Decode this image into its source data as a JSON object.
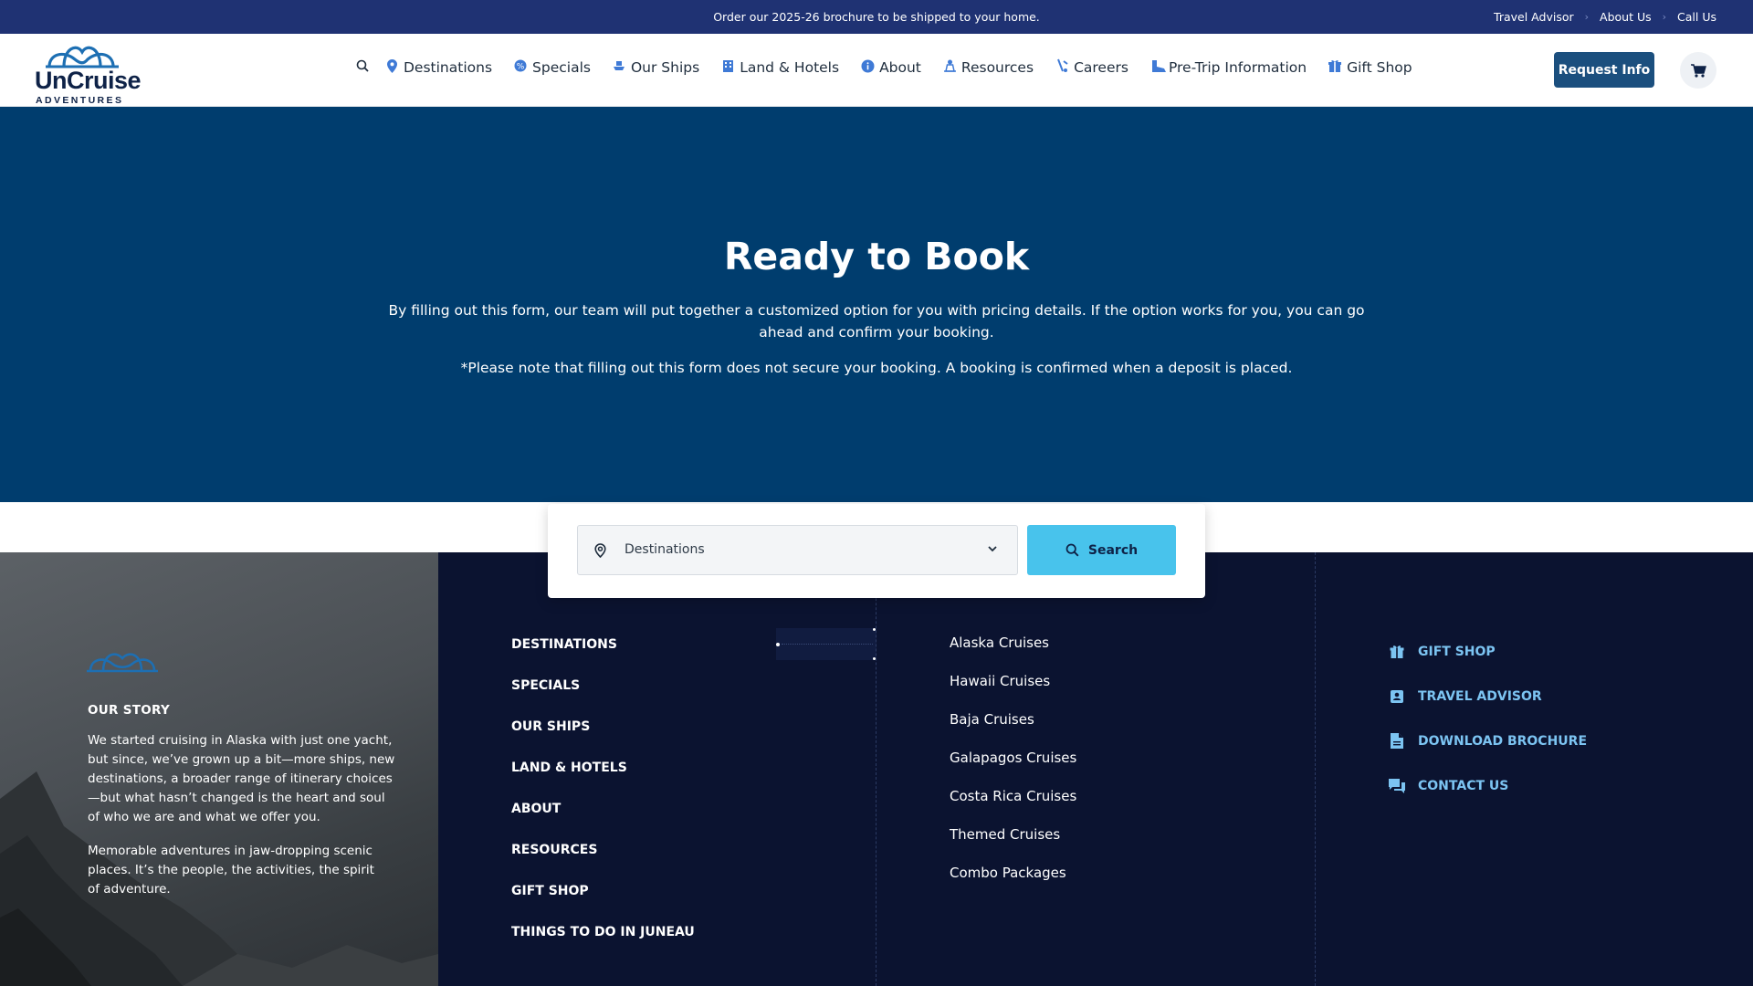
{
  "topbar": {
    "promo": "Order our 2025-26 brochure to be shipped to your home.",
    "links": [
      "Travel Advisor",
      "About Us",
      "Call Us"
    ]
  },
  "header": {
    "logo_word": "UnCruise",
    "logo_sub": "ADVENTURES",
    "nav": [
      {
        "label": "Destinations",
        "icon": "map-pin-icon"
      },
      {
        "label": "Specials",
        "icon": "badge-icon"
      },
      {
        "label": "Our Ships",
        "icon": "ship-icon"
      },
      {
        "label": "Land & Hotels",
        "icon": "hotel-icon"
      },
      {
        "label": "About",
        "icon": "info-icon"
      },
      {
        "label": "Resources",
        "icon": "people-icon"
      },
      {
        "label": "Careers",
        "icon": "careers-icon"
      },
      {
        "label": "Pre-Trip Information",
        "icon": "boot-icon"
      },
      {
        "label": "Gift Shop",
        "icon": "gift-icon"
      }
    ],
    "request_label": "Request Info"
  },
  "hero": {
    "title": "Ready to Book",
    "paragraph": "By filling out this form, our team will put together a customized option for you with pricing details. If the option works for you, you can go ahead and confirm your booking.",
    "note": "*Please note that filling out this form does not secure your booking. A booking is confirmed when a deposit is placed."
  },
  "search": {
    "destination_label": "Destinations",
    "button_label": "Search"
  },
  "footer": {
    "story_title": "OUR STORY",
    "story_p1": "We started cruising in Alaska with just one yacht, but since, we’ve grown up a bit—more ships, new destinations, a broader range of itinerary choices—but what hasn’t changed is the heart and soul of who we are and what we offer you.",
    "story_p2": "Memorable adventures in jaw-dropping scenic places. It’s the people, the activities, the spirit of adventure.",
    "main_links": [
      "DESTINATIONS",
      "SPECIALS",
      "OUR SHIPS",
      "LAND & HOTELS",
      "ABOUT",
      "RESOURCES",
      "GIFT SHOP",
      "THINGS TO DO IN JUNEAU"
    ],
    "destination_links": [
      "Alaska Cruises",
      "Hawaii Cruises",
      "Baja Cruises",
      "Galapagos Cruises",
      "Costa Rica Cruises",
      "Themed Cruises",
      "Combo Packages"
    ],
    "quick_links": [
      {
        "label": "GIFT SHOP",
        "icon": "gift-icon"
      },
      {
        "label": "TRAVEL ADVISOR",
        "icon": "contact-card-icon"
      },
      {
        "label": "DOWNLOAD BROCHURE",
        "icon": "document-icon"
      },
      {
        "label": "CONTACT US",
        "icon": "chat-icon"
      }
    ]
  },
  "colors": {
    "topbar": "#1f3273",
    "hero": "#003d6e",
    "footer": "#0b1330",
    "accent": "#48c3ec",
    "button": "#1b4f7e",
    "quick_link": "#7cc4f2"
  }
}
